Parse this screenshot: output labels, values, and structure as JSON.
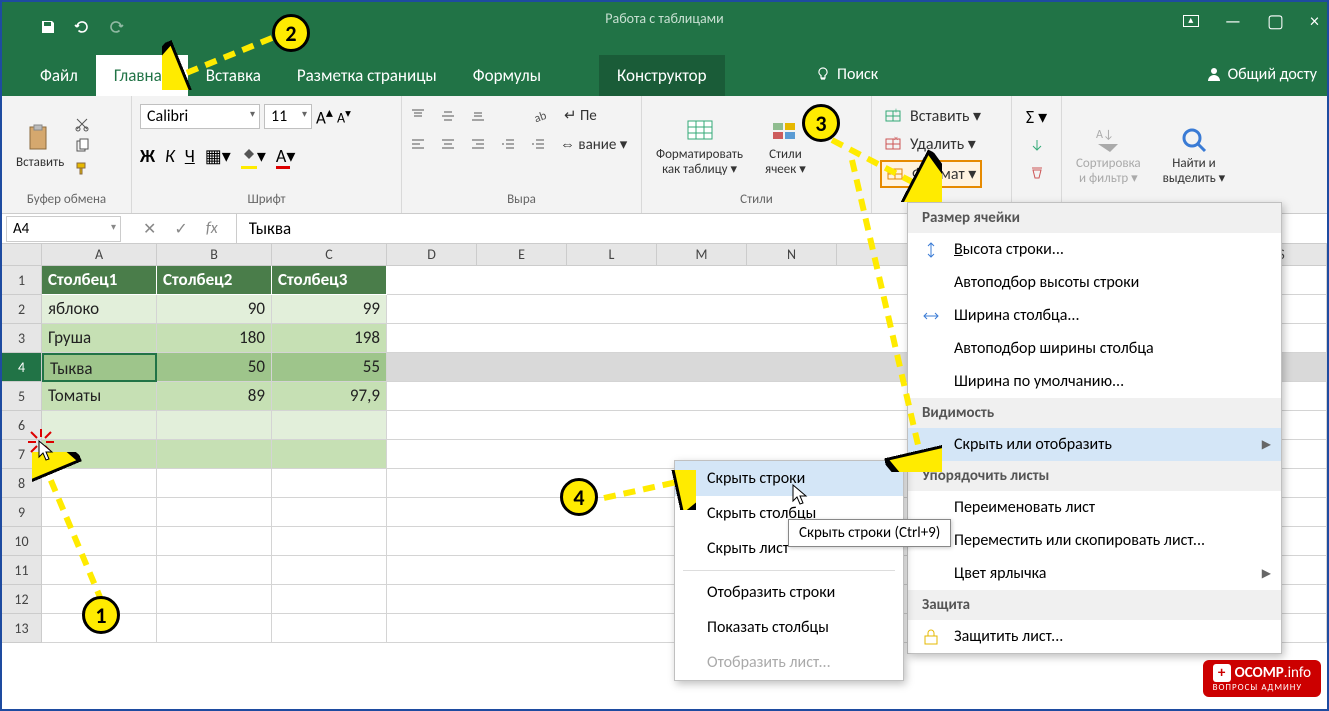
{
  "titlebar": {
    "context_tools": "Работа с таблицами"
  },
  "tabs": {
    "file": "Файл",
    "home": "Главная",
    "insert": "Вставка",
    "layout": "Разметка страницы",
    "formulas": "Формулы",
    "design": "Конструктор",
    "search": "Поиск",
    "share": "Общий досту"
  },
  "ribbon": {
    "clipboard": {
      "label": "Буфер обмена",
      "paste": "Вставить"
    },
    "font": {
      "label": "Шрифт",
      "name": "Calibri",
      "size": "11",
      "bold": "Ж",
      "italic": "К",
      "underline": "Ч"
    },
    "alignment": {
      "label": "Выра",
      "wrap_suffix": "Пе",
      "merge_suffix": "вание ▾"
    },
    "styles": {
      "label": "Стили",
      "format_table": "Форматировать\nкак таблицу ▾",
      "cell_styles": "Стили\nячеек ▾"
    },
    "cells": {
      "insert": "Вставить ▾",
      "delete": "Удалить ▾",
      "format": "Формат ▾"
    },
    "editing": {
      "sort": "Сортировка\nи фильтр ▾",
      "find": "Найти и\nвыделить ▾"
    }
  },
  "formula_bar": {
    "name_box": "A4",
    "fx": "fx",
    "value": "Тыква"
  },
  "columns": [
    "A",
    "B",
    "C",
    "D",
    "E",
    "L",
    "M",
    "N",
    "S"
  ],
  "col_widths": [
    "cw-A",
    "cw-B",
    "cw-C",
    "cw-std",
    "cw-std",
    "cw-std",
    "cw-std",
    "cw-std",
    "cw-std"
  ],
  "table": {
    "headers": [
      "Столбец1",
      "Столбец2",
      "Столбец3"
    ],
    "rows": [
      [
        "яблоко",
        "90",
        "99"
      ],
      [
        "Груша",
        "180",
        "198"
      ],
      [
        "Тыква",
        "50",
        "55"
      ],
      [
        "Томаты",
        "89",
        "97,9"
      ]
    ],
    "selected_row": 4
  },
  "row_numbers": [
    "1",
    "2",
    "3",
    "4",
    "5",
    "6",
    "7",
    "8",
    "9",
    "10",
    "11",
    "12",
    "13"
  ],
  "format_menu": {
    "h1": "Размер ячейки",
    "row_height": "Высота строки...",
    "autofit_row": "Автоподбор высоты строки",
    "col_width": "Ширина столбца...",
    "autofit_col": "Автоподбор ширины столбца",
    "default_width": "Ширина по умолчанию...",
    "h2": "Видимость",
    "hide_show": "Скрыть или отобразить",
    "h3": "Упорядочить листы",
    "rename": "Переименовать лист",
    "move_copy": "Переместить или скопировать лист...",
    "tab_color": "Цвет ярлычка",
    "h4": "Защита",
    "protect": "Защитить лист..."
  },
  "sub_menu": {
    "hide_rows": "Скрыть строки",
    "hide_cols": "Скрыть столбцы",
    "hide_sheet": "Скрыть лист",
    "show_rows": "Отобразить строки",
    "show_cols": "Показать столбцы",
    "show_sheet": "Отобразить лист..."
  },
  "tooltip": "Скрыть строки (Ctrl+9)",
  "callouts": {
    "n1": "1",
    "n2": "2",
    "n3": "3",
    "n4": "4"
  },
  "watermark": {
    "brand": "OCOMP",
    "tld": ".info",
    "sub": "ВОПРОСЫ АДМИНУ"
  }
}
